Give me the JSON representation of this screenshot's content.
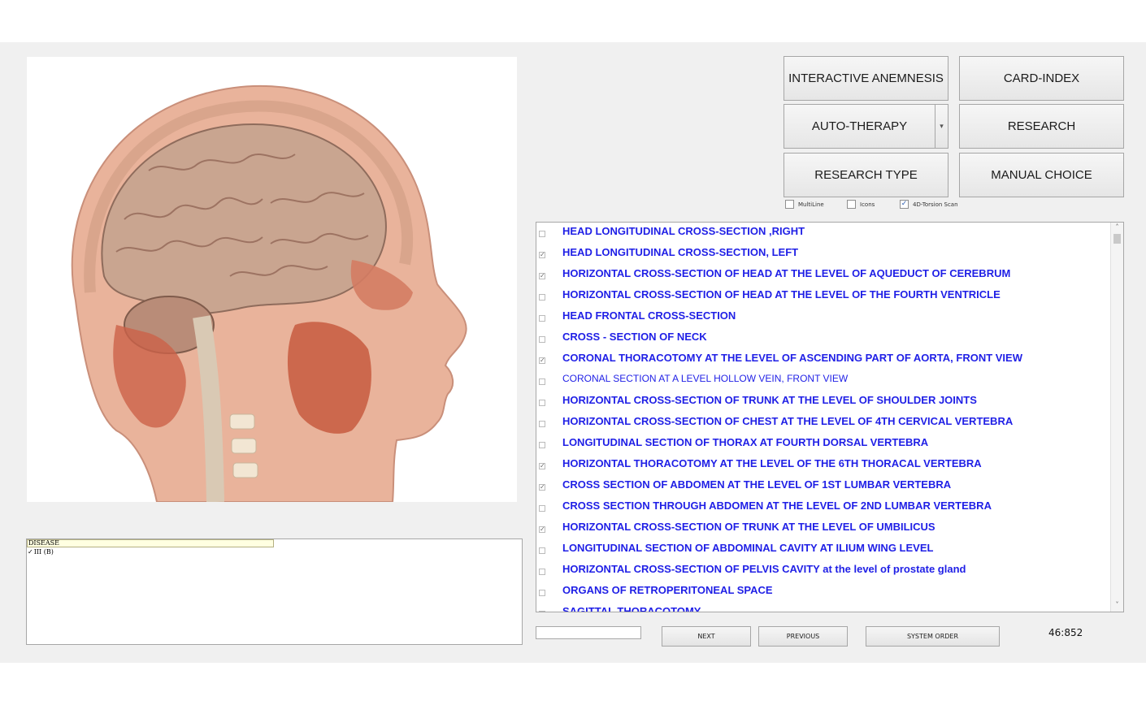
{
  "buttons": {
    "interactive_anemnesis": "INTERACTIVE ANEMNESIS",
    "card_index": "CARD-INDEX",
    "auto_therapy": "AUTO-THERAPY",
    "research": "RESEARCH",
    "research_type": "RESEARCH TYPE",
    "manual_choice": "MANUAL CHOICE",
    "next": "NEXT",
    "previous": "PREVIOUS",
    "system_order": "SYSTEM ORDER"
  },
  "options": {
    "multiline": {
      "label": "MultiLine",
      "checked": false
    },
    "icons": {
      "label": "Icons",
      "checked": false
    },
    "torsion_scan": {
      "label": "4D-Torsion Scan",
      "checked": true
    }
  },
  "disease": {
    "header": "DISEASE",
    "item": "III (B)"
  },
  "list_items": [
    {
      "label": "HEAD LONGITUDINAL CROSS-SECTION ,RIGHT",
      "checked": false,
      "bold": true
    },
    {
      "label": "HEAD LONGITUDINAL CROSS-SECTION, LEFT",
      "checked": true,
      "bold": true
    },
    {
      "label": "HORIZONTAL CROSS-SECTION OF HEAD AT THE LEVEL OF AQUEDUCT OF CEREBRUM",
      "checked": true,
      "bold": true
    },
    {
      "label": "HORIZONTAL CROSS-SECTION OF HEAD AT THE LEVEL OF THE FOURTH VENTRICLE",
      "checked": false,
      "bold": true
    },
    {
      "label": "HEAD FRONTAL CROSS-SECTION",
      "checked": false,
      "bold": true
    },
    {
      "label": "CROSS - SECTION  OF   NECK",
      "checked": false,
      "bold": true
    },
    {
      "label": "CORONAL THORACOTOMY AT THE LEVEL OF ASCENDING PART OF AORTA, FRONT VIEW",
      "checked": true,
      "bold": true
    },
    {
      "label": "CORONAL SECTION AT A LEVEL HOLLOW VEIN, FRONT VIEW",
      "checked": false,
      "bold": false
    },
    {
      "label": "HORIZONTAL CROSS-SECTION OF TRUNK AT THE LEVEL OF SHOULDER JOINTS",
      "checked": false,
      "bold": true
    },
    {
      "label": "HORIZONTAL CROSS-SECTION OF CHEST AT THE LEVEL OF 4TH CERVICAL VERTEBRA",
      "checked": false,
      "bold": true
    },
    {
      "label": "LONGITUDINAL SECTION OF THORAX AT FOURTH DORSAL VERTEBRA",
      "checked": false,
      "bold": true
    },
    {
      "label": "HORIZONTAL THORACOTOMY AT THE LEVEL OF THE 6TH THORACAL VERTEBRA",
      "checked": true,
      "bold": true
    },
    {
      "label": "CROSS SECTION OF ABDOMEN AT THE LEVEL OF 1ST LUMBAR VERTEBRA",
      "checked": true,
      "bold": true
    },
    {
      "label": "CROSS SECTION THROUGH ABDOMEN AT THE LEVEL OF 2ND LUMBAR VERTEBRA",
      "checked": false,
      "bold": true
    },
    {
      "label": "HORIZONTAL CROSS-SECTION OF TRUNK AT THE LEVEL OF UMBILICUS",
      "checked": true,
      "bold": true
    },
    {
      "label": "LONGITUDINAL SECTION OF ABDOMINAL CAVITY AT ILIUM WING LEVEL",
      "checked": false,
      "bold": true
    },
    {
      "label": "HORIZONTAL CROSS-SECTION OF PELVIS CAVITY at the level of prostate gland",
      "checked": false,
      "bold": true
    },
    {
      "label": "ORGANS OF RETROPERITONEAL SPACE",
      "checked": false,
      "bold": true
    },
    {
      "label": "SAGITTAL THORACOTOMY",
      "checked": false,
      "bold": true
    }
  ],
  "search": {
    "value": ""
  },
  "counter": "46:852",
  "colors": {
    "list_text": "#1f1fe6",
    "window_bg": "#f0f0f0",
    "tooltip_bg": "#ffffe1"
  },
  "icons": {
    "check": "check-icon",
    "dropdown": "chevron-down-icon",
    "scroll_up": "chevron-up-icon",
    "scroll_down": "chevron-down-icon"
  }
}
